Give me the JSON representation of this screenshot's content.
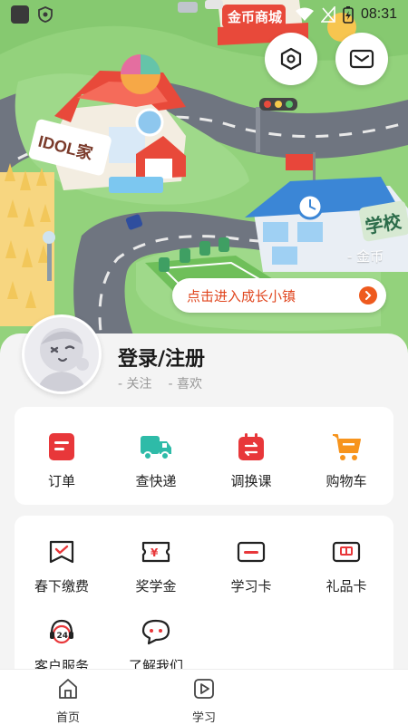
{
  "status_bar": {
    "time": "08:31"
  },
  "scene": {
    "shop_sign": "金币商城",
    "idol_sign": "IDOL家",
    "school_sign": "学校",
    "coin_label": "- 金币",
    "town_button": "点击进入成长小镇"
  },
  "profile": {
    "login_label": "登录/注册",
    "follow_label": "- 关注",
    "like_label": "- 喜欢"
  },
  "orders": [
    {
      "label": "订单",
      "icon": "order-icon"
    },
    {
      "label": "查快递",
      "icon": "truck-icon"
    },
    {
      "label": "调换课",
      "icon": "calendar-swap-icon"
    },
    {
      "label": "购物车",
      "icon": "cart-icon"
    }
  ],
  "services": [
    {
      "label": "春下缴费",
      "icon": "payment-check-icon"
    },
    {
      "label": "奖学金",
      "icon": "scholarship-ticket-icon"
    },
    {
      "label": "学习卡",
      "icon": "study-card-icon"
    },
    {
      "label": "礼品卡",
      "icon": "gift-card-icon"
    },
    {
      "label": "客户服务",
      "icon": "customer-service-24-icon"
    },
    {
      "label": "了解我们",
      "icon": "about-us-chat-icon"
    }
  ],
  "bottom_nav": [
    {
      "label": "首页",
      "icon": "home-icon"
    },
    {
      "label": "学习",
      "icon": "play-icon"
    }
  ],
  "colors": {
    "accent_red": "#e8373a",
    "teal": "#2ebba8",
    "orange": "#f7941d",
    "grass": "#8fd07a"
  }
}
